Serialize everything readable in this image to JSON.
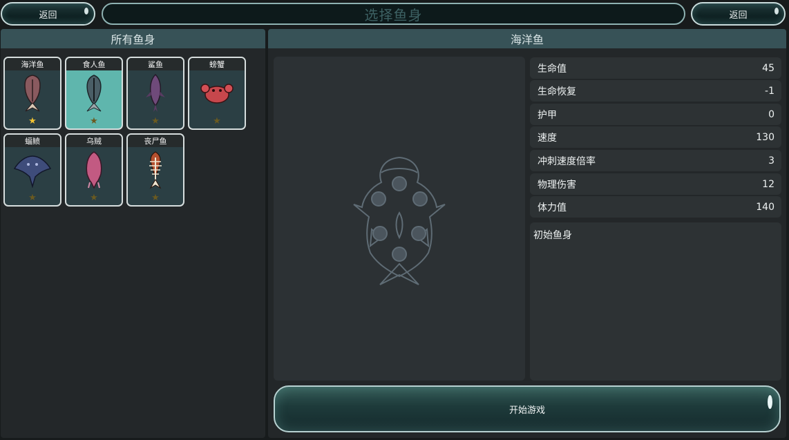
{
  "header": {
    "back_left_label": "返回",
    "title": "选择鱼身",
    "back_right_label": "返回"
  },
  "left_panel": {
    "title": "所有鱼身",
    "cards": [
      {
        "name": "海洋鱼",
        "icon": "ocean-fish-icon",
        "star_lit": true,
        "selected": false
      },
      {
        "name": "食人鱼",
        "icon": "piranha-icon",
        "star_lit": false,
        "selected": true
      },
      {
        "name": "鲨鱼",
        "icon": "shark-icon",
        "star_lit": false,
        "selected": false
      },
      {
        "name": "螃蟹",
        "icon": "crab-icon",
        "star_lit": false,
        "selected": false
      },
      {
        "name": "蝠鲼",
        "icon": "manta-ray-icon",
        "star_lit": false,
        "selected": false
      },
      {
        "name": "乌贼",
        "icon": "squid-icon",
        "star_lit": false,
        "selected": false
      },
      {
        "name": "丧尸鱼",
        "icon": "zombie-fish-icon",
        "star_lit": false,
        "selected": false
      }
    ]
  },
  "right_panel": {
    "title": "海洋鱼",
    "stats": [
      {
        "label": "生命值",
        "value": "45"
      },
      {
        "label": "生命恢复",
        "value": "-1"
      },
      {
        "label": "护甲",
        "value": "0"
      },
      {
        "label": "速度",
        "value": "130"
      },
      {
        "label": "冲刺速度倍率",
        "value": "3"
      },
      {
        "label": "物理伤害",
        "value": "12"
      },
      {
        "label": "体力值",
        "value": "140"
      }
    ],
    "description": "初始鱼身",
    "start_label": "开始游戏"
  },
  "colors": {
    "panel_header": "#375257",
    "selected_card": "#5fb6ad",
    "star_lit": "#f1c232",
    "star_dim": "#6b5a20"
  }
}
